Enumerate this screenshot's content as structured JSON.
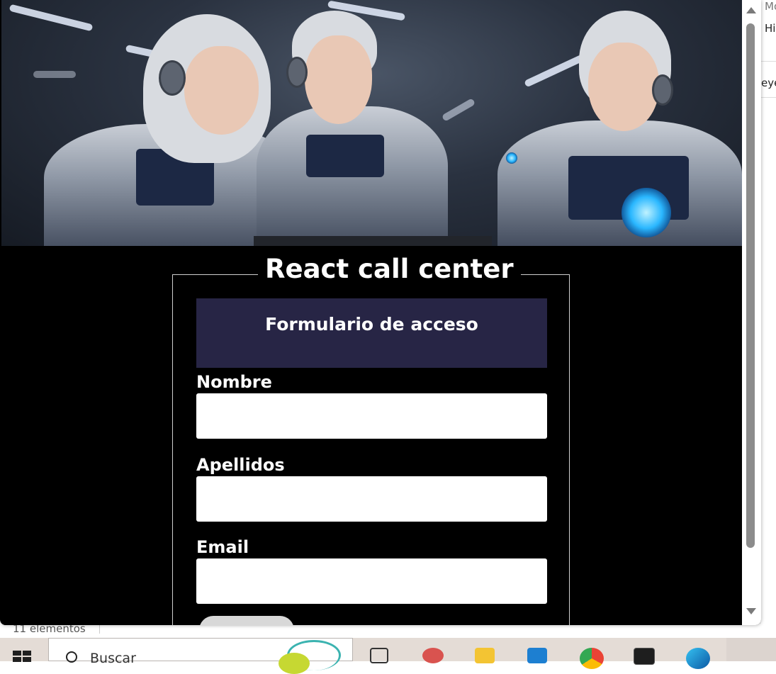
{
  "background": {
    "right_panel_texts": [
      "Mo",
      "Hi",
      "eye"
    ],
    "status_count": "11 elementos"
  },
  "page": {
    "title": "React call center",
    "form": {
      "header": "Formulario de acceso",
      "fields": [
        {
          "label": "Nombre",
          "value": ""
        },
        {
          "label": "Apellidos",
          "value": ""
        },
        {
          "label": "Email",
          "value": ""
        }
      ],
      "submit_label": ""
    }
  },
  "colors": {
    "page_background": "#000000",
    "form_header": "#272545",
    "taskbar": "#e4dcd6"
  },
  "taskbar": {
    "search_placeholder": "Buscar",
    "icons": [
      "start-icon",
      "task-view-icon",
      "app-icon",
      "file-explorer-icon",
      "vscode-icon",
      "chrome-icon",
      "terminal-icon",
      "edge-icon"
    ]
  }
}
